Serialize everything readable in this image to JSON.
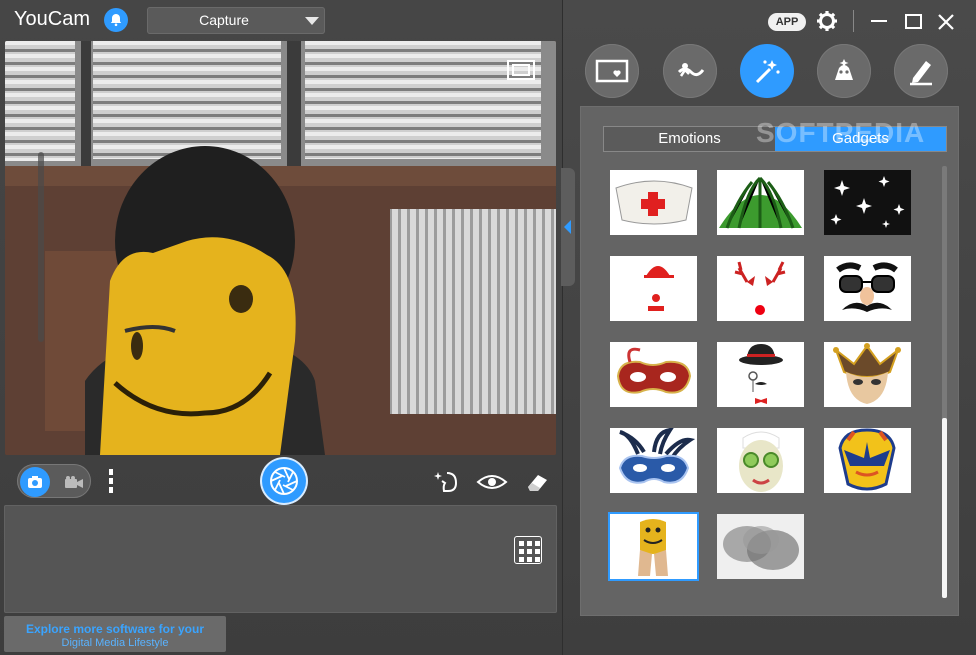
{
  "app": {
    "title": "YouCam"
  },
  "mode_select": {
    "value": "Capture"
  },
  "promo": {
    "line1": "Explore more software for your",
    "line2": "Digital Media Lifestyle"
  },
  "window": {
    "app_badge": "APP"
  },
  "feature_tabs": [
    {
      "icon": "frame-icon",
      "active": false
    },
    {
      "icon": "particle-effect-icon",
      "active": false
    },
    {
      "icon": "magic-wand-icon",
      "active": true
    },
    {
      "icon": "face-distortion-icon",
      "active": false
    },
    {
      "icon": "draw-pen-icon",
      "active": false
    }
  ],
  "tabs": {
    "emotions": "Emotions",
    "gadgets": "Gadgets",
    "selected": "Gadgets"
  },
  "watermark": "SOFTPEDIA",
  "gadgets": [
    {
      "icon": "nurse-hat-icon"
    },
    {
      "icon": "watermelon-hat-icon"
    },
    {
      "icon": "sparkles-icon"
    },
    {
      "icon": "clown-hat-nose-icon"
    },
    {
      "icon": "reindeer-antlers-icon"
    },
    {
      "icon": "groucho-glasses-icon"
    },
    {
      "icon": "red-venetian-mask-icon"
    },
    {
      "icon": "bowler-hat-monocle-icon"
    },
    {
      "icon": "jester-mask-icon"
    },
    {
      "icon": "blue-feather-mask-icon"
    },
    {
      "icon": "cucumber-face-mask-icon"
    },
    {
      "icon": "hero-helmet-icon"
    },
    {
      "icon": "smiley-hands-icon",
      "selected": true
    },
    {
      "icon": "smoke-blur-icon"
    }
  ],
  "colors": {
    "accent": "#2f9bff",
    "panel": "#464646",
    "content": "#646464"
  }
}
